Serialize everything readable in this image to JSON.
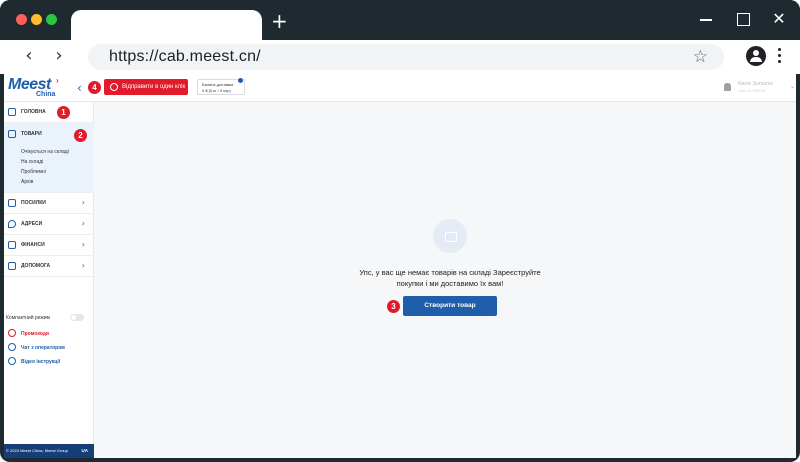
{
  "browser": {
    "url": "https://cab.meest.cn/",
    "new_tab_glyph": "+",
    "back_glyph": "‹",
    "forward_glyph": "›",
    "star_glyph": "☆",
    "close_glyph": "✕"
  },
  "header": {
    "logo_text": "Meest",
    "logo_sub": "China",
    "collapse_glyph": "‹",
    "send_button": "Відправити в один клік",
    "balance_label": "Баланс доставки",
    "balance_value": "0 $ (0 кг / 0 кор)",
    "user_name": "Name Surname",
    "user_sub": "User ID 000000"
  },
  "sidebar": {
    "home": "ГОЛОВНА",
    "goods": "ТОВАРИ",
    "goods_sub": [
      "Очікується на складі",
      "На складі",
      "Проблемні",
      "Архів"
    ],
    "parcels": "ПОСИЛКИ",
    "addresses": "АДРЕСИ",
    "finances": "ФІНАНСИ",
    "help": "ДОПОМОГА",
    "compact_mode": "Компактний режим",
    "promocodes": "Промокоди",
    "operator_chat": "Чат з оператором",
    "video_guides": "Відео інструкцiї",
    "footer_copy": "© 2020 Meest China, Meest Group",
    "footer_lang": "UA",
    "chevron_right": "›",
    "chevron_up": "⌃"
  },
  "main": {
    "empty_text": "Упс, у вас ще немає товарів на складі Зареєструйте покупки і ми доставимо їх вам!",
    "create_button": "Створити товар"
  },
  "badges": [
    "1",
    "2",
    "3",
    "4"
  ],
  "colors": {
    "accent": "#1f5eaa",
    "red": "#e21a2a",
    "frame": "#1e2a30"
  }
}
